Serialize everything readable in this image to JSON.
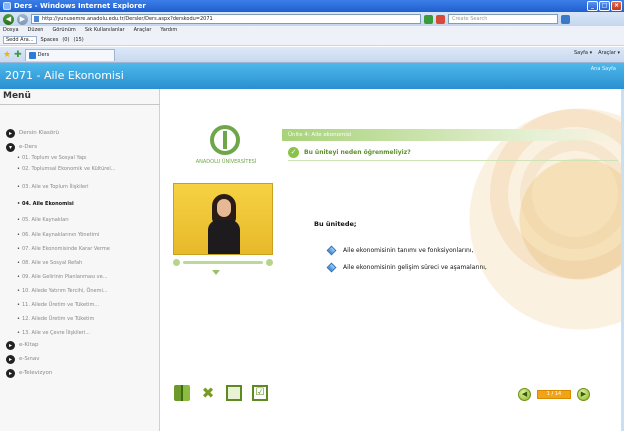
{
  "window": {
    "title": "Ders - Windows Internet Explorer",
    "url": "http://yunusemre.anadolu.edu.tr/Dersler/Ders.aspx?derskodu=2071",
    "search_placeholder": "Create Search",
    "min_glyph": "_",
    "max_glyph": "□",
    "close_glyph": "×",
    "back_glyph": "◀",
    "forward_glyph": "▶"
  },
  "menubar": [
    "Dosya",
    "Düzen",
    "Görünüm",
    "Sık Kullanılanlar",
    "Araçlar",
    "Yardım"
  ],
  "linksbar": {
    "field": "Sedd Ara...",
    "spaces": "Spaces",
    "mail_count": "(0)",
    "feed_count": "(15)"
  },
  "tab": {
    "label": "Ders",
    "tools": [
      "Sayfa ▾",
      "Araçlar ▾"
    ]
  },
  "site": {
    "title": "2071 - Aile Ekonomisi",
    "help_link": "Ana Sayfa"
  },
  "sidebar": {
    "heading": "Menü",
    "sections": [
      {
        "label": "Dersin Klasörü",
        "bullet": "▸"
      },
      {
        "label": "e-Ders",
        "bullet": "▾"
      },
      {
        "label": "e-Kitap",
        "bullet": "▸"
      },
      {
        "label": "e-Sınav",
        "bullet": "▸"
      },
      {
        "label": "e-Televizyon",
        "bullet": "▸"
      }
    ],
    "items": [
      "01. Toplum ve Sosyal Yapı",
      "02. Toplumsal Ekonomik ve Kültürel...",
      "03. Aile ve Toplum İlişkileri",
      "04. Aile Ekonomisi",
      "05. Aile Kaynakları",
      "06. Aile Kaynaklarının Yönetimi",
      "07. Aile Ekonomisinde Karar Verme",
      "08. Aile ve Sosyal Refah",
      "09. Aile Gelirinin Planlanması ve...",
      "10. Ailede Yatırım Tercihi, Önemi...",
      "11. Ailede Üretim ve Tüketim...",
      "12. Ailede Üretim ve Tüketim",
      "13. Aile ve Çevre İlişkileri..."
    ],
    "active_index": 3
  },
  "content": {
    "logo_text": "ANADOLU ÜNİVERSİTESİ",
    "unit_header": "Ünite 4: Aile ekonomisi",
    "objective_heading": "Bu üniteyi neden öğrenmeliyiz?",
    "check_glyph": "✓",
    "intro": "Bu ünitede;",
    "points": [
      "Aile ekonomisinin tanımı ve fonksiyonlarını,",
      "Aile ekonomisinin gelişim süreci ve aşamalarını,"
    ],
    "page_number": "1 / 14",
    "prev_glyph": "◀",
    "next_glyph": "▶",
    "tools_glyph": "✖",
    "checklist_glyph": "☑"
  },
  "colors": {
    "header_blue": "#2a8fd1",
    "accent_green": "#8bc34a",
    "page_orange": "#f2a416"
  }
}
